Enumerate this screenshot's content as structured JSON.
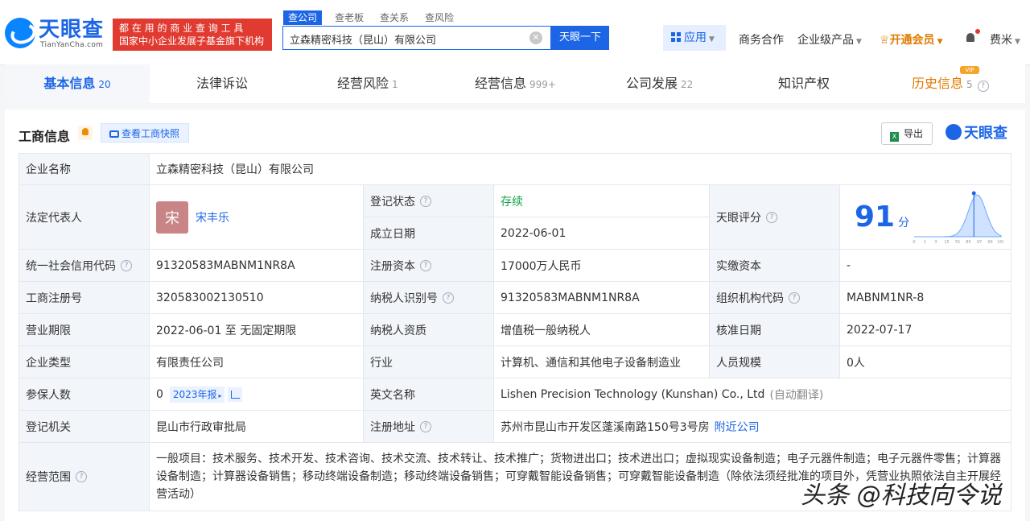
{
  "header": {
    "logo_text": "天眼查",
    "logo_sub": "TianYanCha.com",
    "slogan_line1": "都 在 用 的 商 业 查 询 工 具",
    "slogan_line2": "国家中小企业发展子基金旗下机构",
    "search_tabs": [
      "查公司",
      "查老板",
      "查关系",
      "查风险"
    ],
    "search_value": "立森精密科技（昆山）有限公司",
    "search_button": "天眼一下",
    "app_label": "应用",
    "nav": [
      "商务合作",
      "企业级产品",
      "开通会员",
      "费米"
    ]
  },
  "tabs": [
    {
      "label": "基本信息",
      "count": "20"
    },
    {
      "label": "法律诉讼",
      "count": ""
    },
    {
      "label": "经营风险",
      "count": "1"
    },
    {
      "label": "经营信息",
      "count": "999+"
    },
    {
      "label": "公司发展",
      "count": "22"
    },
    {
      "label": "知识产权",
      "count": ""
    },
    {
      "label": "历史信息",
      "count": "5"
    }
  ],
  "vip_badge": "VIP",
  "section": {
    "title": "工商信息",
    "snapshot_button": "查看工商快照",
    "export_button": "导出",
    "watermark_brand": "天眼查"
  },
  "info": {
    "company_name_label": "企业名称",
    "company_name": "立森精密科技（昆山）有限公司",
    "legal_rep_label": "法定代表人",
    "legal_rep_avatar": "宋",
    "legal_rep": "宋丰乐",
    "status_label": "登记状态",
    "status": "存续",
    "found_date_label": "成立日期",
    "found_date": "2022-06-01",
    "score_label": "天眼评分",
    "score": "91",
    "score_unit": "分",
    "credit_code_label": "统一社会信用代码",
    "credit_code": "91320583MABNM1NR8A",
    "reg_capital_label": "注册资本",
    "reg_capital": "17000万人民币",
    "paid_capital_label": "实缴资本",
    "paid_capital": "-",
    "reg_no_label": "工商注册号",
    "reg_no": "320583002130510",
    "taxpayer_id_label": "纳税人识别号",
    "taxpayer_id": "91320583MABNM1NR8A",
    "org_code_label": "组织机构代码",
    "org_code": "MABNM1NR-8",
    "term_label": "营业期限",
    "term": "2022-06-01 至 无固定期限",
    "tax_qual_label": "纳税人资质",
    "tax_qual": "增值税一般纳税人",
    "approve_date_label": "核准日期",
    "approve_date": "2022-07-17",
    "type_label": "企业类型",
    "type": "有限责任公司",
    "industry_label": "行业",
    "industry": "计算机、通信和其他电子设备制造业",
    "staff_size_label": "人员规模",
    "staff_size": "0人",
    "insured_label": "参保人数",
    "insured": "0",
    "insured_report": "2023年报",
    "english_name_label": "英文名称",
    "english_name": "Lishen Precision Technology (Kunshan) Co., Ltd",
    "auto_translate": "(自动翻译)",
    "authority_label": "登记机关",
    "authority": "昆山市行政审批局",
    "address_label": "注册地址",
    "address": "苏州市昆山市开发区蓬溪南路150号3号房",
    "nearby": "附近公司",
    "scope_label": "经营范围",
    "scope": "一般项目：技术服务、技术开发、技术咨询、技术交流、技术转让、技术推广；货物进出口；技术进出口；虚拟现实设备制造；电子元器件制造；电子元器件零售；计算器设备制造；计算器设备销售；移动终端设备制造；移动终端设备销售；可穿戴智能设备销售；可穿戴智能设备制造（除依法须经批准的项目外，凭营业执照依法自主开展经营活动）"
  },
  "score_chart": {
    "x_ticks": [
      "0",
      "1",
      "3",
      "15",
      "55",
      "85",
      "97",
      "99",
      "100"
    ],
    "marker_value": 91
  },
  "watermark": "头条 @科技向令说"
}
